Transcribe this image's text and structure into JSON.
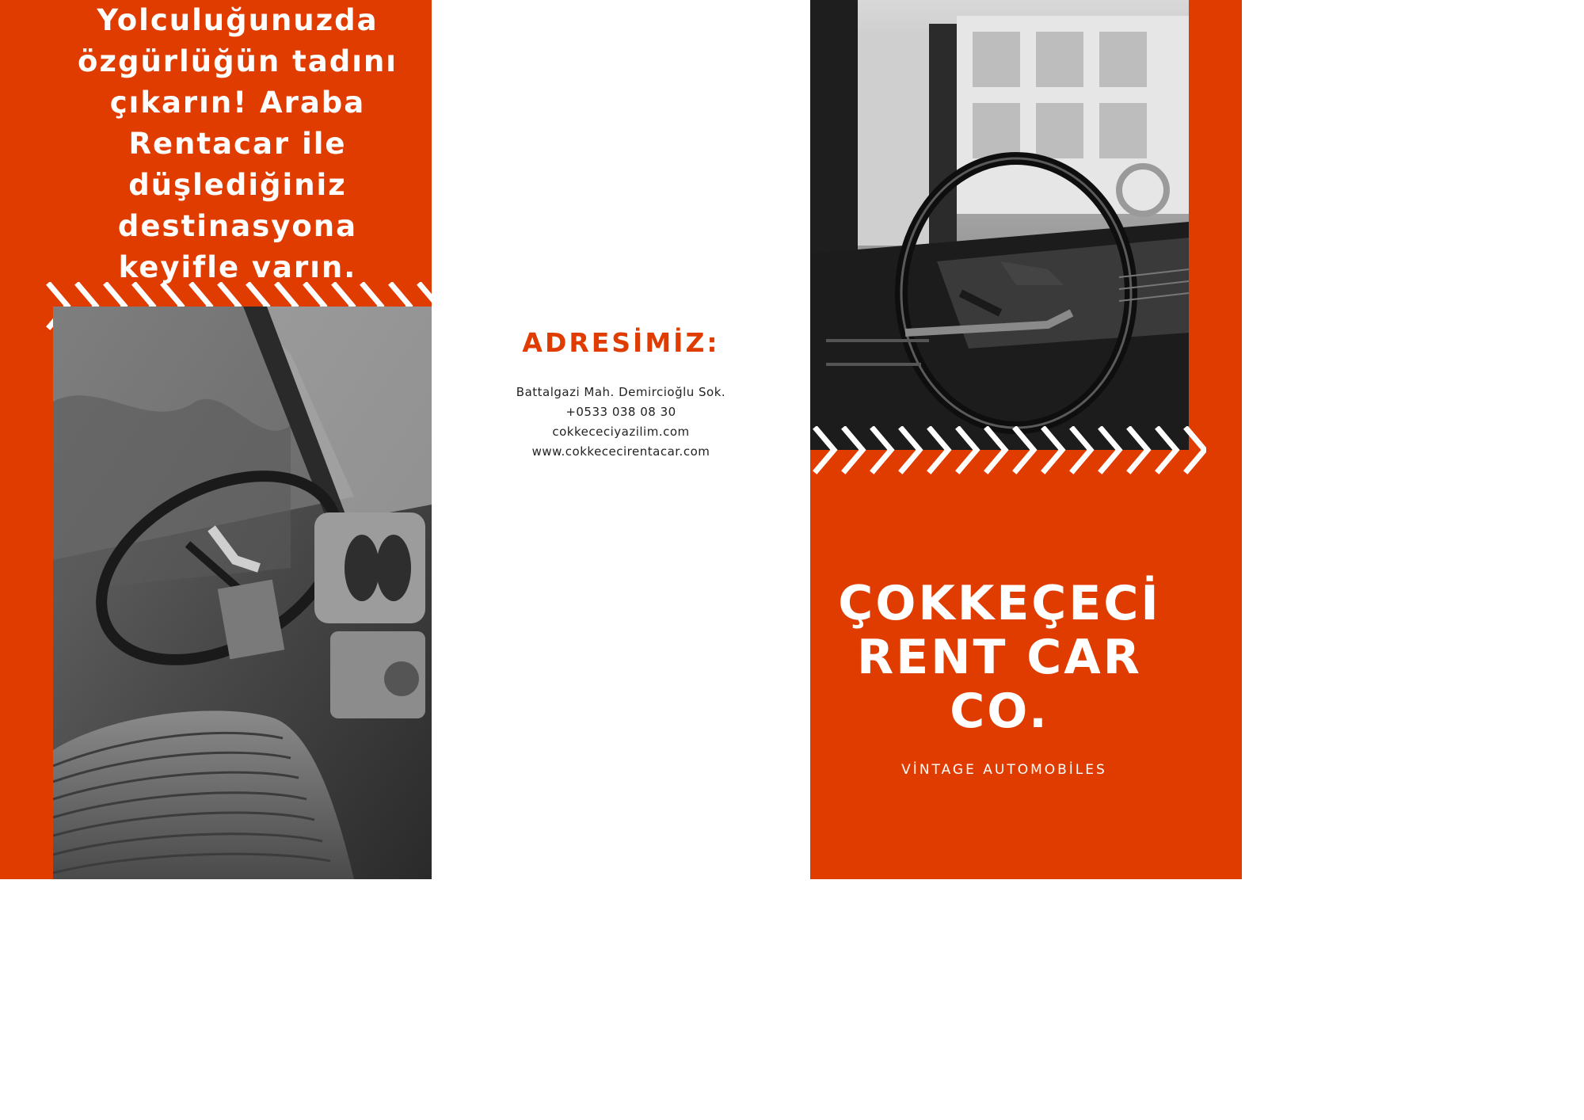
{
  "colors": {
    "accent": "#e03c00",
    "text_light": "#ffffff",
    "text_dark": "#222222",
    "background": "#ffffff"
  },
  "left_panel": {
    "tagline": "Yolculuğunuzda\nözgürlüğün tadını\nçıkarın! Araba\nRentacar ile\ndüşlediğiniz\ndestinasyona\nkeyifle varın."
  },
  "middle_panel": {
    "address_heading": "ADRESİMİZ:",
    "contact": {
      "address": "Battalgazi Mah. Demircioğlu Sok.",
      "phone": "+0533 038 08 30",
      "email": "cokkececiyazilim.com",
      "website": "www.cokkececirentacar.com"
    }
  },
  "right_panel": {
    "company_name": "ÇOKKEÇECİ\nRENT CAR\nCO.",
    "subtitle": "VİNTAGE AUTOMOBİLES"
  }
}
